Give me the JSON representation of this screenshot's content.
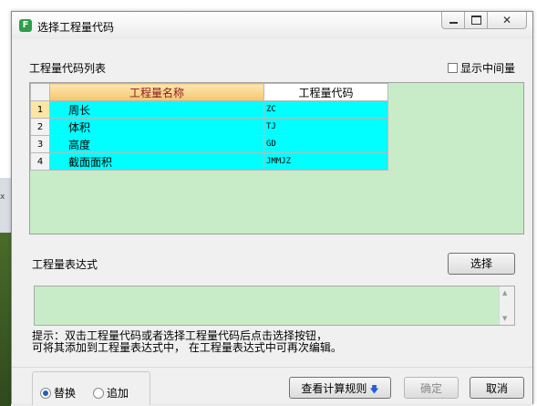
{
  "window": {
    "title": "选择工程量代码",
    "icon": "app-icon",
    "icon_glyph": "F"
  },
  "list_section": {
    "label": "工程量代码列表",
    "show_intermediate_label": "显示中间量",
    "show_intermediate_checked": false
  },
  "grid": {
    "columns": [
      "工程量名称",
      "工程量代码"
    ],
    "rows": [
      {
        "num": "1",
        "name": "周长",
        "code": "ZC"
      },
      {
        "num": "2",
        "name": "体积",
        "code": "TJ"
      },
      {
        "num": "3",
        "name": "高度",
        "code": "GD"
      },
      {
        "num": "4",
        "name": "截面面积",
        "code": "JMMJZ"
      }
    ],
    "selected_row": 1
  },
  "expression": {
    "label": "工程量表达式",
    "select_button": "选择",
    "value": ""
  },
  "hint": {
    "line1": "提示：双击工程量代码或者选择工程量代码后点击选择按钮，",
    "line2": "可将其添加到工程量表达式中， 在工程量表达式中可再次编辑。"
  },
  "mode": {
    "replace_label": "替换",
    "append_label": "追加",
    "selected": "替换"
  },
  "buttons": {
    "view_rules": "查看计算规则",
    "ok": "确定",
    "cancel": "取消"
  },
  "colors": {
    "grid_bg": "#c8ecc8",
    "cell_bg": "#00ffff",
    "header_name_bg": "#f4c76c",
    "header_name_text": "#8a1a1a"
  }
}
